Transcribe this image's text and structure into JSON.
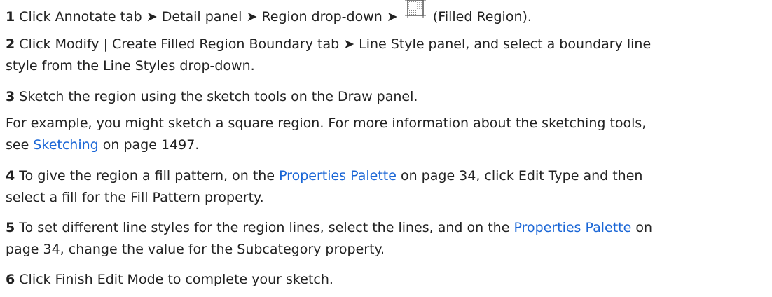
{
  "steps": [
    {
      "number": "1",
      "parts": {
        "a": "Click Annotate tab ➤ Detail panel ➤ Region drop-down ➤",
        "b": "(Filled Region)."
      }
    },
    {
      "number": "2",
      "line1": "Click Modify | Create Filled Region Boundary tab ➤ Line Style panel, and select a boundary line",
      "line2": "style from the Line Styles drop-down."
    },
    {
      "number": "3",
      "text": "Sketch the region using the sketch tools on the Draw panel.",
      "note_line1": "For example, you might sketch a square region. For more information about the sketching tools,",
      "note_see": "see ",
      "note_link": "Sketching",
      "note_tail": " on page 1497."
    },
    {
      "number": "4",
      "a": "To give the region a fill pattern, on the ",
      "link": "Properties Palette",
      "b": " on page 34, click Edit Type and then",
      "line2": "select a fill for the Fill Pattern property."
    },
    {
      "number": "5",
      "a": "To set different line styles for the region lines, select the lines, and on the ",
      "link": "Properties Palette",
      "b": " on",
      "line2": "page 34, change the value for the Subcategory property."
    },
    {
      "number": "6",
      "text": "Click Finish Edit Mode to complete your sketch."
    }
  ],
  "icon": "filled-region-icon",
  "link_color": "#1a66d6"
}
